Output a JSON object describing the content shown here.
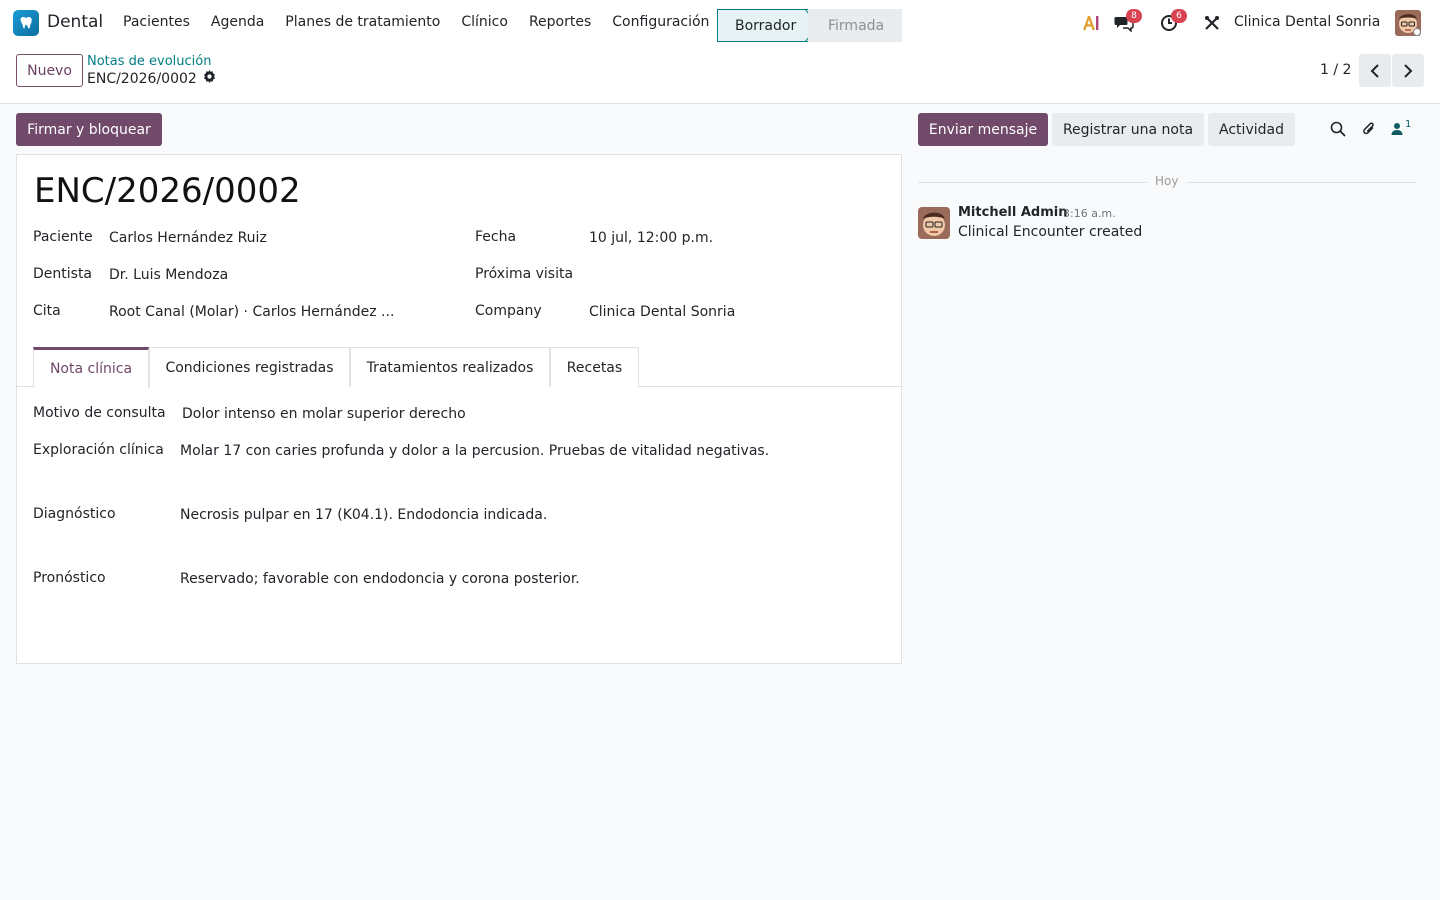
{
  "app": {
    "name": "Dental"
  },
  "menu": [
    "Pacientes",
    "Agenda",
    "Planes de tratamiento",
    "Clínico",
    "Reportes",
    "Configuración"
  ],
  "systray": {
    "messages_count": "8",
    "activities_count": "6",
    "company": "Clinica Dental Sonria"
  },
  "control_panel": {
    "new_label": "Nuevo",
    "breadcrumb_parent": "Notas de evolución",
    "breadcrumb_current": "ENC/2026/0002",
    "pager": "1 / 2"
  },
  "statusbar": {
    "sign_label": "Firmar y bloquear",
    "stages": [
      "Borrador",
      "Firmada"
    ],
    "active_stage": "Borrador"
  },
  "record": {
    "title": "ENC/2026/0002",
    "fields_left": [
      {
        "label": "Paciente",
        "value": "Carlos Hernández Ruiz"
      },
      {
        "label": "Dentista",
        "value": "Dr. Luis Mendoza"
      },
      {
        "label": "Cita",
        "value": "Root Canal (Molar) · Carlos Hernández ..."
      }
    ],
    "fields_right": [
      {
        "label": "Fecha",
        "value": "10 jul, 12:00 p.m."
      },
      {
        "label": "Próxima visita",
        "value": ""
      },
      {
        "label": "Company",
        "value": "Clinica Dental Sonria"
      }
    ],
    "tabs": [
      "Nota clínica",
      "Condiciones registradas",
      "Tratamientos realizados",
      "Recetas"
    ],
    "clinical_note": [
      {
        "label": "Motivo de consulta",
        "value": "Dolor intenso en molar superior derecho"
      },
      {
        "label": "Exploración clínica",
        "value": "Molar 17 con caries profunda y dolor a la percusion. Pruebas de vitalidad negativas."
      },
      {
        "label": "Diagnóstico",
        "value": "Necrosis pulpar en 17 (K04.1). Endodoncia indicada."
      },
      {
        "label": "Pronóstico",
        "value": "Reservado; favorable con endodoncia y corona posterior."
      }
    ]
  },
  "chatter": {
    "send_label": "Enviar mensaje",
    "note_label": "Registrar una nota",
    "activity_label": "Actividad",
    "followers_count": "1",
    "date_divider": "Hoy",
    "messages": [
      {
        "author": "Mitchell Admin",
        "time": "3:16 a.m.",
        "body": "Clinical Encounter created"
      }
    ]
  },
  "colors": {
    "brand": "#71496a",
    "accent": "#017e84",
    "badge": "#d94452"
  }
}
